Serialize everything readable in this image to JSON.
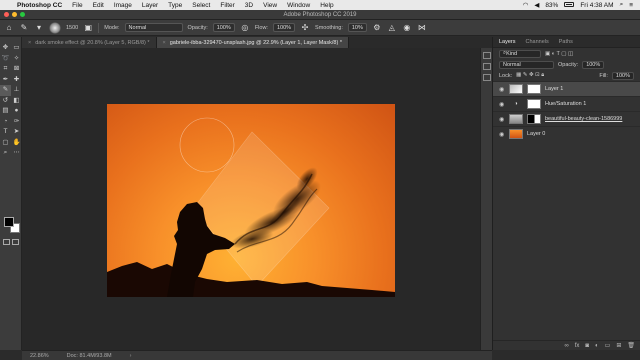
{
  "menubar": {
    "apple": "",
    "app": "Photoshop CC",
    "items": [
      "File",
      "Edit",
      "Image",
      "Layer",
      "Type",
      "Select",
      "Filter",
      "3D",
      "View",
      "Window",
      "Help"
    ],
    "battery": "83%",
    "clock": "Fri 4:38 AM"
  },
  "window": {
    "title": "Adobe Photoshop CC 2019"
  },
  "options": {
    "brush_size": "1500",
    "mode_label": "Mode:",
    "mode_value": "Normal",
    "opacity_label": "Opacity:",
    "opacity_value": "100%",
    "flow_label": "Flow:",
    "flow_value": "100%",
    "smoothing_label": "Smoothing:",
    "smoothing_value": "10%"
  },
  "tabs": [
    {
      "label": "dark smoke effect @ 20.8% (Layer 5, RGB/8) *"
    },
    {
      "label": "gabriele-ibba-329470-unsplash.jpg @ 22.9% (Layer 1, Layer Mask/8) *"
    }
  ],
  "panels": {
    "tabs": [
      "Layers",
      "Channels",
      "Paths"
    ],
    "kind": "Kind",
    "blend": "Normal",
    "opacity_label": "Opacity:",
    "opacity_value": "100%",
    "lock_label": "Lock:",
    "fill_label": "Fill:",
    "fill_value": "100%",
    "layers": [
      {
        "name": "Layer 1"
      },
      {
        "name": "Hue/Saturation 1"
      },
      {
        "name": "beautiful-beauty-clean-1586999"
      },
      {
        "name": "Layer 0"
      }
    ]
  },
  "status": {
    "zoom": "22.86%",
    "doc": "Doc: 81.4M/93.8M"
  },
  "colors": {
    "foreground": "#000000",
    "background": "#ffffff",
    "accent": "#31a8ff"
  }
}
